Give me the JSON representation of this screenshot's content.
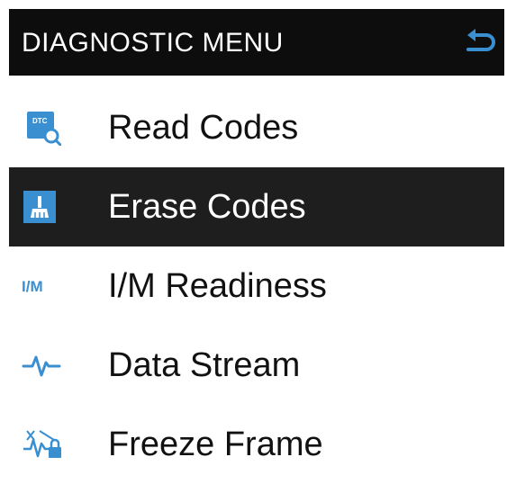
{
  "header": {
    "title": "DIAGNOSTIC MENU",
    "back_icon": "return-arrow-icon"
  },
  "menu": {
    "selected_index": 1,
    "items": [
      {
        "label": "Read Codes",
        "icon": "dtc-magnifier-icon",
        "icon_text": "DTC"
      },
      {
        "label": "Erase Codes",
        "icon": "broom-icon"
      },
      {
        "label": "I/M Readiness",
        "icon": "im-icon",
        "icon_text": "I/M"
      },
      {
        "label": "Data Stream",
        "icon": "waveform-icon"
      },
      {
        "label": "Freeze Frame",
        "icon": "frozen-waveform-lock-icon"
      }
    ]
  },
  "colors": {
    "header_bg": "#0d0d0d",
    "selected_bg": "#1e1e1e",
    "accent_blue": "#3a8fd0",
    "text": "#111111"
  }
}
